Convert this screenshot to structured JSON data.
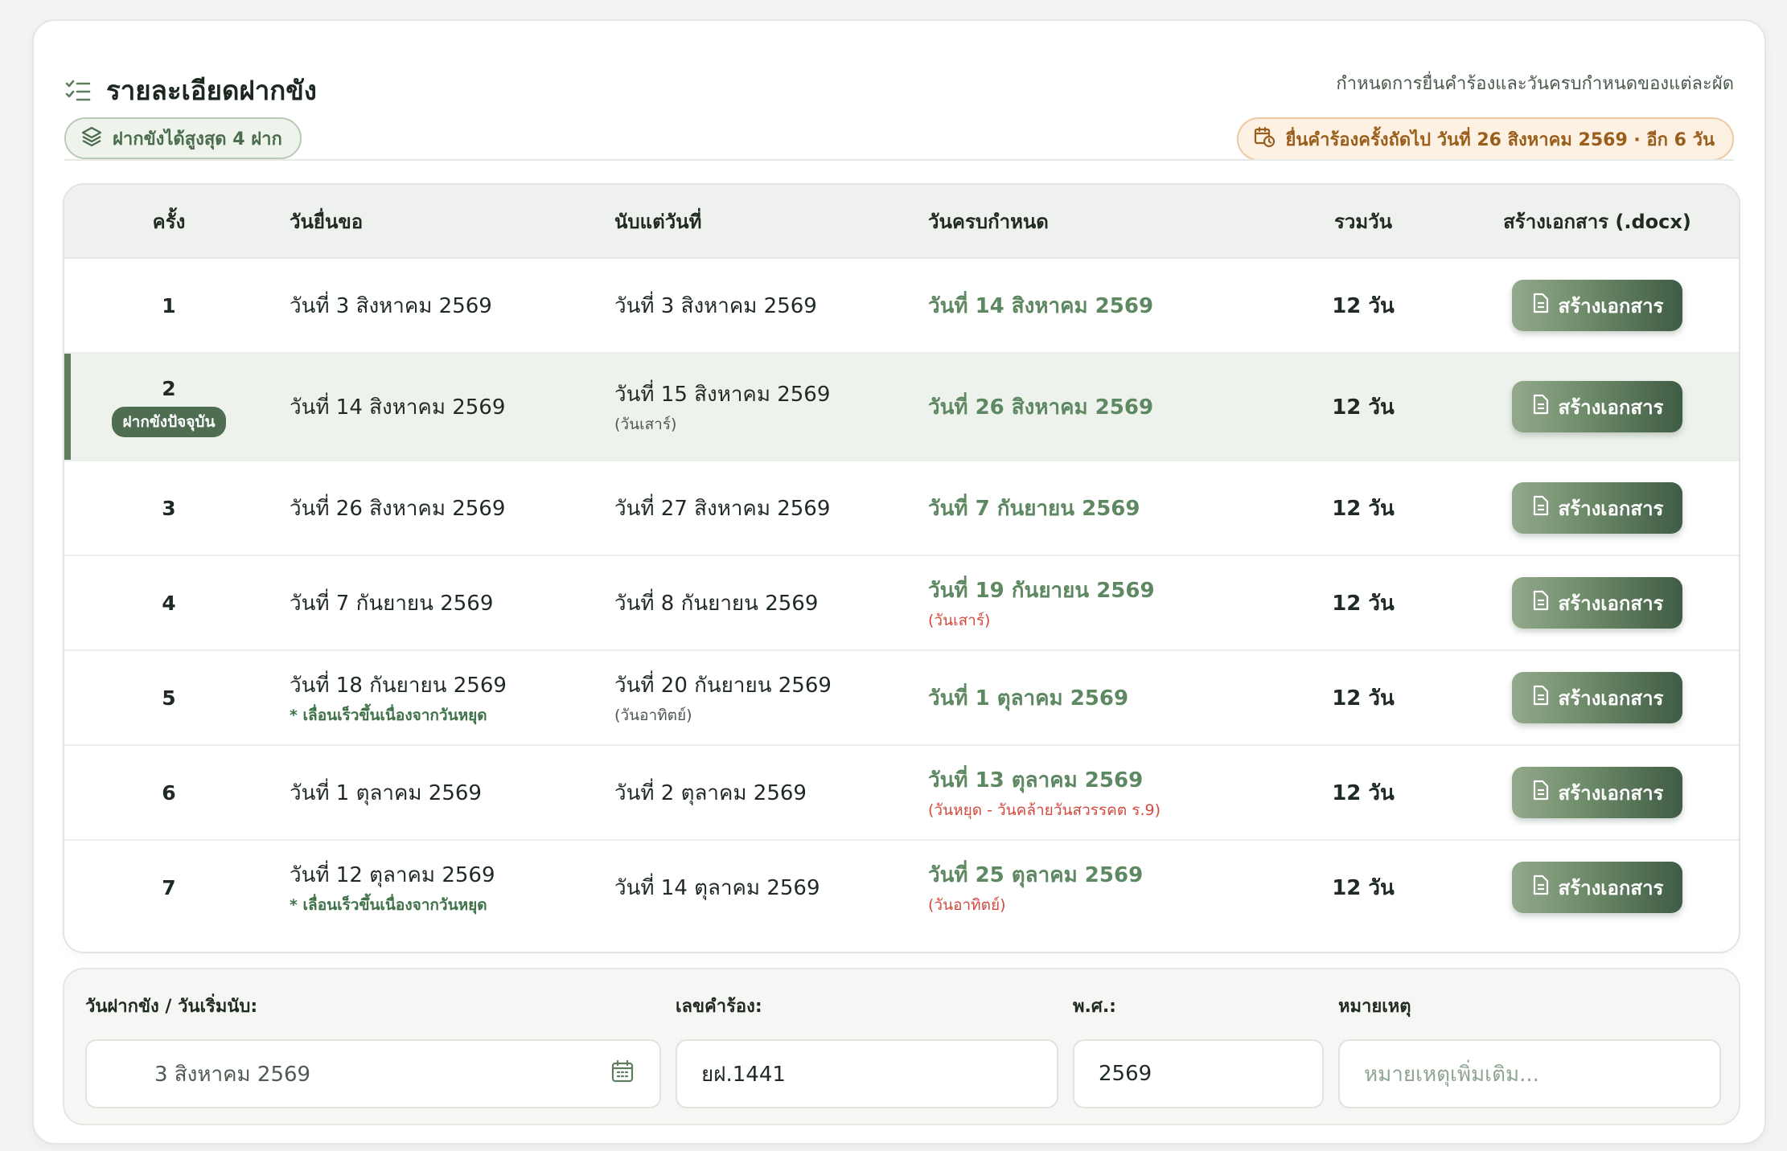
{
  "header": {
    "title": "รายละเอียดฝากขัง",
    "max_badge": "ฝากขังได้สูงสุด 4 ฝาก",
    "subtitle": "กำหนดการยื่นคำร้องและวันครบกำหนดของแต่ละผัด",
    "next_filing": "ยื่นคำร้องครั้งถัดไป วันที่ 26 สิงหาคม 2569 · อีก 6 วัน"
  },
  "table": {
    "columns": [
      "ครั้ง",
      "วันยื่นขอ",
      "นับแต่วันที่",
      "วันครบกำหนด",
      "รวมวัน",
      "สร้างเอกสาร (.docx)"
    ],
    "current_badge": "ฝากขังปัจจุบัน",
    "button_label": "สร้างเอกสาร",
    "rows": [
      {
        "no": "1",
        "filed": "วันที่ 3 สิงหาคม 2569",
        "filed_note": "",
        "from": "วันที่ 3 สิงหาคม 2569",
        "from_note": "",
        "due": "วันที่ 14 สิงหาคม 2569",
        "due_note": "",
        "days": "12 วัน"
      },
      {
        "no": "2",
        "filed": "วันที่ 14 สิงหาคม 2569",
        "filed_note": "",
        "from": "วันที่ 15 สิงหาคม 2569",
        "from_note": "(วันเสาร์)",
        "due": "วันที่ 26 สิงหาคม 2569",
        "due_note": "",
        "days": "12 วัน"
      },
      {
        "no": "3",
        "filed": "วันที่ 26 สิงหาคม 2569",
        "filed_note": "",
        "from": "วันที่ 27 สิงหาคม 2569",
        "from_note": "",
        "due": "วันที่ 7 กันยายน 2569",
        "due_note": "",
        "days": "12 วัน"
      },
      {
        "no": "4",
        "filed": "วันที่ 7 กันยายน 2569",
        "filed_note": "",
        "from": "วันที่ 8 กันยายน 2569",
        "from_note": "",
        "due": "วันที่ 19 กันยายน 2569",
        "due_note": "(วันเสาร์)",
        "days": "12 วัน"
      },
      {
        "no": "5",
        "filed": "วันที่ 18 กันยายน 2569",
        "filed_note": "* เลื่อนเร็วขึ้นเนื่องจากวันหยุด",
        "from": "วันที่ 20 กันยายน 2569",
        "from_note": "(วันอาทิตย์)",
        "due": "วันที่ 1 ตุลาคม 2569",
        "due_note": "",
        "days": "12 วัน"
      },
      {
        "no": "6",
        "filed": "วันที่ 1 ตุลาคม 2569",
        "filed_note": "",
        "from": "วันที่ 2 ตุลาคม 2569",
        "from_note": "",
        "due": "วันที่ 13 ตุลาคม 2569",
        "due_note": "(วันหยุด - วันคล้ายวันสวรรคต ร.9)",
        "days": "12 วัน"
      },
      {
        "no": "7",
        "filed": "วันที่ 12 ตุลาคม 2569",
        "filed_note": "* เลื่อนเร็วขึ้นเนื่องจากวันหยุด",
        "from": "วันที่ 14 ตุลาคม 2569",
        "from_note": "",
        "due": "วันที่ 25 ตุลาคม 2569",
        "due_note": "(วันอาทิตย์)",
        "days": "12 วัน"
      }
    ]
  },
  "form": {
    "date_label": "วันฝากขัง / วันเริ่มนับ:",
    "date_value": "3 สิงหาคม 2569",
    "case_label": "เลขคำร้อง:",
    "case_value": "ยฝ.1441",
    "year_label": "พ.ศ.:",
    "year_value": "2569",
    "note_label": "หมายเหตุ",
    "note_placeholder": "หมายเหตุเพิ่มเติม..."
  },
  "colors": {
    "accent": "#5f7e5f",
    "due_green": "#5d8862",
    "holiday_red": "#d24a3f",
    "warning": "#9a5e1b"
  }
}
